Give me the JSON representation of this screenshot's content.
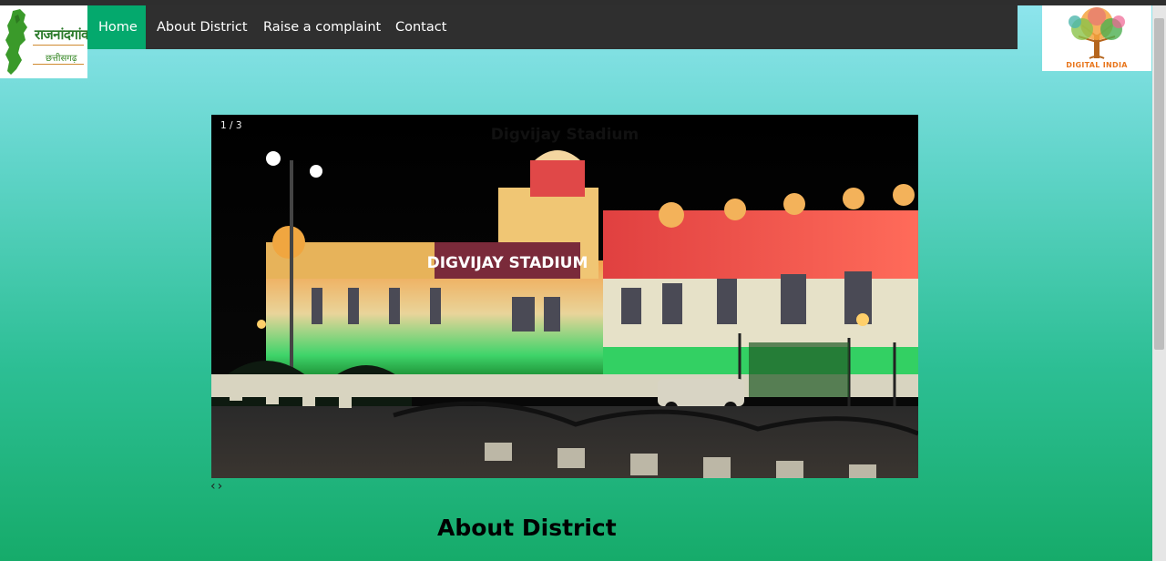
{
  "header": {
    "logo_left_text_line1": "राजनांदगांव",
    "logo_left_text_line2": "छत्तीसगढ़",
    "logo_right_text": "DIGITAL INDIA"
  },
  "nav": {
    "items": [
      {
        "label": "Home",
        "active": true
      },
      {
        "label": "About District",
        "active": false
      },
      {
        "label": "Raise a complaint",
        "active": false
      },
      {
        "label": "Contact",
        "active": false
      }
    ]
  },
  "slideshow": {
    "counter": "1 / 3",
    "caption": "Digvijay Stadium",
    "sign_text": "DIGVIJAY STADIUM",
    "prev_icon": "chevron-left-icon",
    "next_icon": "chevron-right-icon",
    "prev_glyph": "‹",
    "next_glyph": "›"
  },
  "main": {
    "section_title": "About District"
  },
  "colors": {
    "nav_bg": "#2f2f2f",
    "nav_active": "#04a96d",
    "gradient_top": "#8fe5ee",
    "gradient_bottom": "#16ab6a"
  }
}
